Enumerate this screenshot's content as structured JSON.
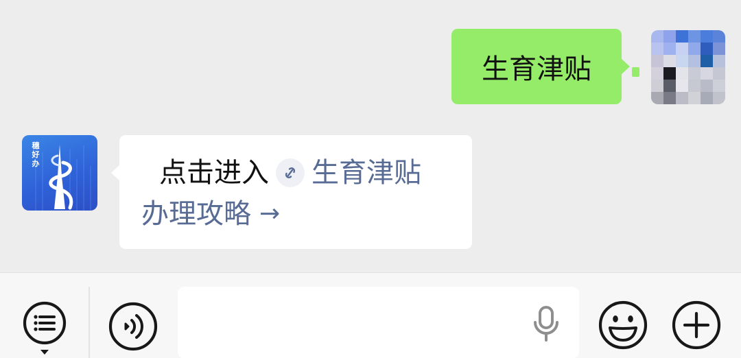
{
  "chat": {
    "outgoing": {
      "text": "生育津贴"
    },
    "incoming": {
      "sender_logo_text": "穗\n好\n办",
      "line1_prefix": "点击进入",
      "line1_link": "生育津贴",
      "line2_link": "办理攻略",
      "arrow": "→"
    }
  },
  "input_bar": {
    "left_menu_icon": "list-menu-icon",
    "voice_toggle_icon": "voice-toggle-icon",
    "mic_icon": "microphone-icon",
    "emoji_icon": "emoji-icon",
    "plus_icon": "plus-icon",
    "text_value": "",
    "placeholder": ""
  },
  "colors": {
    "background": "#ededed",
    "outgoing_bubble": "#95ec69",
    "incoming_bubble": "#ffffff",
    "link": "#576b95",
    "icon_stroke": "#181818"
  }
}
